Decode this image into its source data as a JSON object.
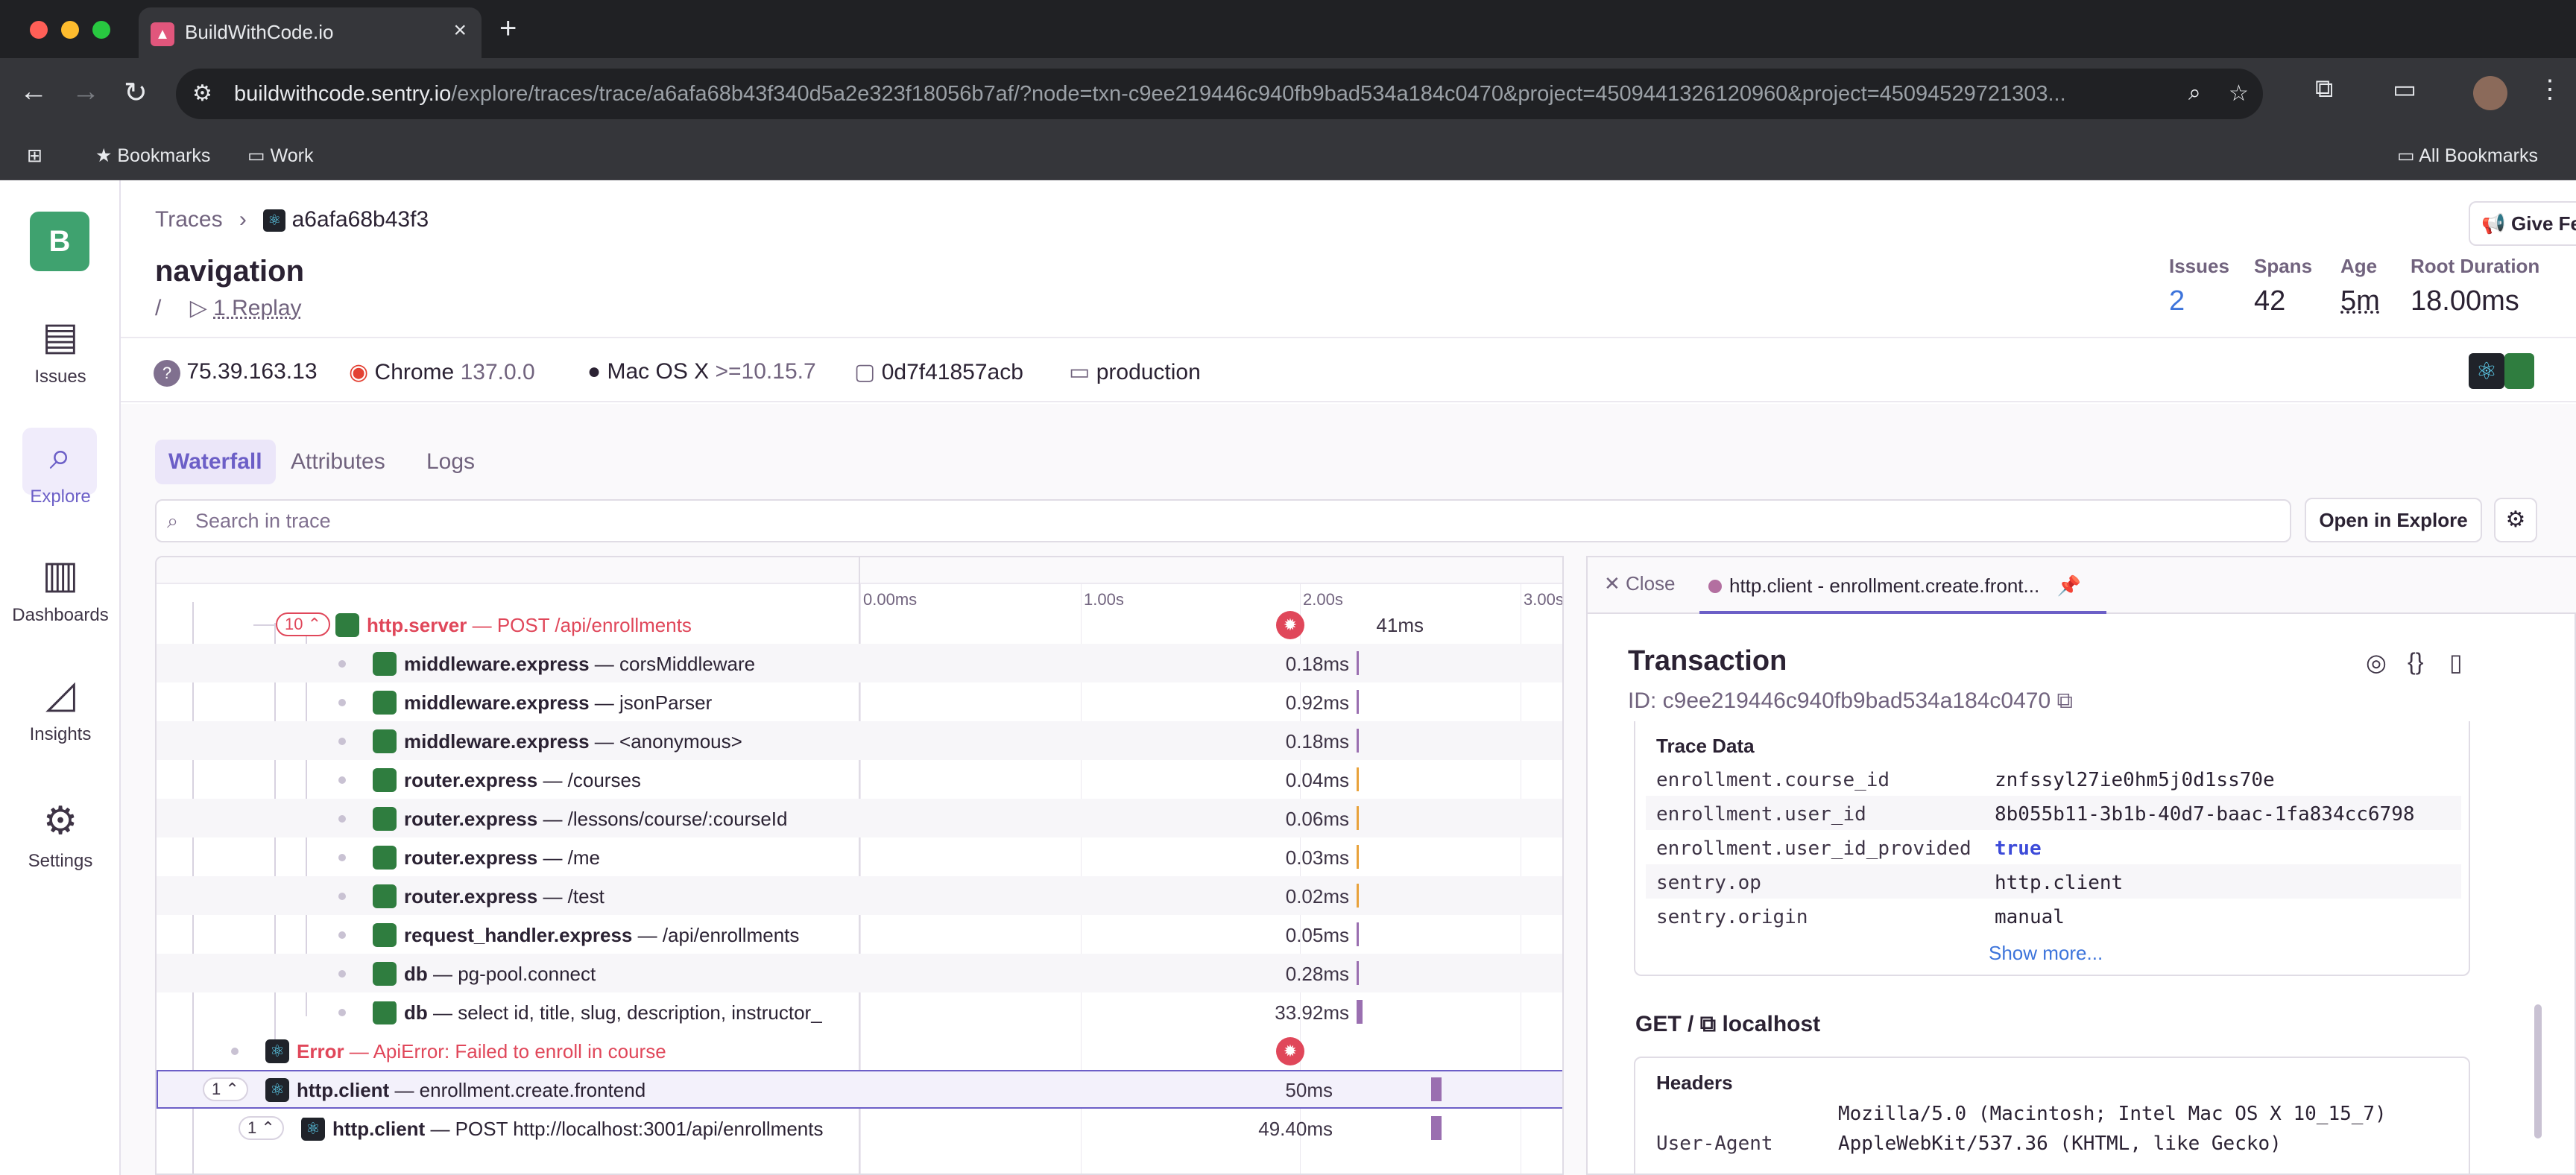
{
  "browser": {
    "tab_title": "BuildWithCode.io",
    "url_host": "buildwithcode.sentry.io",
    "url_path": "/explore/traces/trace/a6afa68b43f340d5a2e323f18056b7af/?node=txn-c9ee219446c940fb9bad534a184c0470&project=4509441326120960&project=45094529721303...",
    "bookmarks": [
      "Bookmarks",
      "Work"
    ],
    "all_bookmarks": "All Bookmarks"
  },
  "nav": {
    "org_initial": "B",
    "items": [
      {
        "label": "Issues"
      },
      {
        "label": "Explore"
      },
      {
        "label": "Dashboards"
      },
      {
        "label": "Insights"
      },
      {
        "label": "Settings"
      }
    ]
  },
  "header": {
    "breadcrumb_root": "Traces",
    "breadcrumb_trace": "a6afa68b43f3",
    "title": "navigation",
    "path": "/",
    "replay": "1 Replay",
    "feedback": "Give Feedback",
    "stats": [
      {
        "label": "Issues",
        "value": "2"
      },
      {
        "label": "Spans",
        "value": "42"
      },
      {
        "label": "Age",
        "value": "5m"
      },
      {
        "label": "Root Duration",
        "value": "18.00ms"
      }
    ]
  },
  "meta": {
    "ip": "75.39.163.13",
    "browser": "Chrome",
    "browser_version": "137.0.0",
    "os": "Mac OS X",
    "os_version": ">=10.15.7",
    "release": "0d7f41857acb",
    "environment": "production"
  },
  "tabs": [
    "Waterfall",
    "Attributes",
    "Logs"
  ],
  "search_placeholder": "Search in trace",
  "open_in_explore": "Open in Explore",
  "timeline_ticks": [
    "0.00ms",
    "1.00s",
    "2.00s",
    "3.00s"
  ],
  "rows": [
    {
      "count": "10",
      "op": "http.server",
      "desc": " — POST /api/enrollments",
      "dur": "41ms",
      "error": true
    },
    {
      "op": "middleware.express",
      "desc": " — corsMiddleware",
      "dur": "0.18ms"
    },
    {
      "op": "middleware.express",
      "desc": " — jsonParser",
      "dur": "0.92ms"
    },
    {
      "op": "middleware.express",
      "desc": " — <anonymous>",
      "dur": "0.18ms"
    },
    {
      "op": "router.express",
      "desc": " — /courses",
      "dur": "0.04ms"
    },
    {
      "op": "router.express",
      "desc": " — /lessons/course/:courseId",
      "dur": "0.06ms"
    },
    {
      "op": "router.express",
      "desc": " — /me",
      "dur": "0.03ms"
    },
    {
      "op": "router.express",
      "desc": " — /test",
      "dur": "0.02ms"
    },
    {
      "op": "request_handler.express",
      "desc": " — /api/enrollments",
      "dur": "0.05ms"
    },
    {
      "op": "db",
      "desc": " — pg-pool.connect",
      "dur": "0.28ms"
    },
    {
      "op": "db",
      "desc": " — select id, title, slug, description, instructor_",
      "dur": "33.92ms"
    },
    {
      "op": "Error",
      "desc": " — ApiError: Failed to enroll in course",
      "dur": ""
    },
    {
      "count": "1",
      "op": "http.client",
      "desc": " — enrollment.create.frontend",
      "dur": "50ms"
    },
    {
      "count": "1",
      "op": "http.client",
      "desc": " — POST http://localhost:3001/api/enrollments",
      "dur": "49.40ms"
    }
  ],
  "drawer": {
    "close": "Close",
    "tab": "http.client - enrollment.create.front...",
    "title": "Transaction",
    "id": "ID: c9ee219446c940fb9bad534a184c0470",
    "trace_data_title": "Trace Data",
    "trace_data": [
      {
        "k": "enrollment.course_id",
        "v": "znfssyl27ie0hm5j0d1ss70e"
      },
      {
        "k": "enrollment.user_id",
        "v": "8b055b11-3b1b-40d7-baac-1fa834cc6798"
      },
      {
        "k": "enrollment.user_id_provided",
        "v": "true"
      },
      {
        "k": "sentry.op",
        "v": "http.client"
      },
      {
        "k": "sentry.origin",
        "v": "manual"
      }
    ],
    "show_more": "Show more...",
    "get_label": "GET /",
    "get_host": "localhost",
    "headers_title": "Headers",
    "ua_line1": "Mozilla/5.0 (Macintosh; Intel Mac OS X 10_15_7)",
    "ua_key": "User-Agent",
    "ua_line2": "AppleWebKit/537.36 (KHTML, like Gecko)"
  },
  "colors": {
    "accent": "#6c5fc7",
    "error": "#e0475a",
    "bar": "#9a6fb0"
  }
}
